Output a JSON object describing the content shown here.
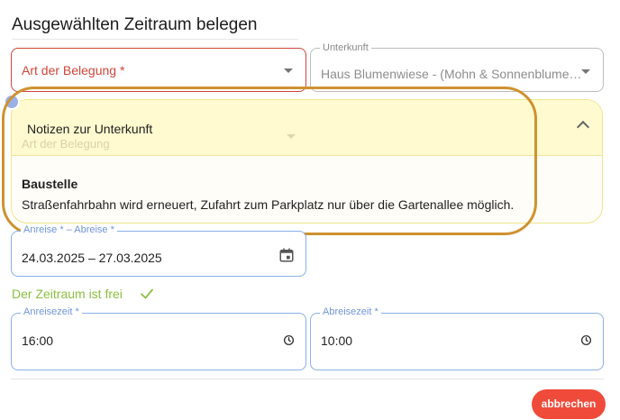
{
  "dialog": {
    "title": "Ausgewählten Zeitraum belegen"
  },
  "belegung": {
    "label": "Art der Belegung *"
  },
  "unterkunft": {
    "legend": "Unterkunft",
    "value": "Haus Blumenwiese - (Mohn & Sonnenblume)..."
  },
  "notes": {
    "title": "Notizen zur Unterkunft",
    "ghost_label": "Art der Belegung",
    "heading": "Baustelle",
    "body": "Straßenfahrbahn wird erneuert, Zufahrt zum Parkplatz nur über die Gartenallee möglich."
  },
  "dates": {
    "legend": "Anreise * – Abreise *",
    "value": "24.03.2025 – 27.03.2025"
  },
  "availability": {
    "text": "Der Zeitraum ist frei"
  },
  "anreisezeit": {
    "legend": "Anreisezeit *",
    "value": "16:00"
  },
  "abreisezeit": {
    "legend": "Abreisezeit *",
    "value": "10:00"
  },
  "actions": {
    "cancel_label": "abbrechen"
  },
  "colors": {
    "error": "#d0453a",
    "accent_blue": "#8ab0e8",
    "success": "#8cbf3f",
    "notes_bg": "#fffad0",
    "highlight": "#cf9230",
    "cancel": "#f04b3a"
  }
}
